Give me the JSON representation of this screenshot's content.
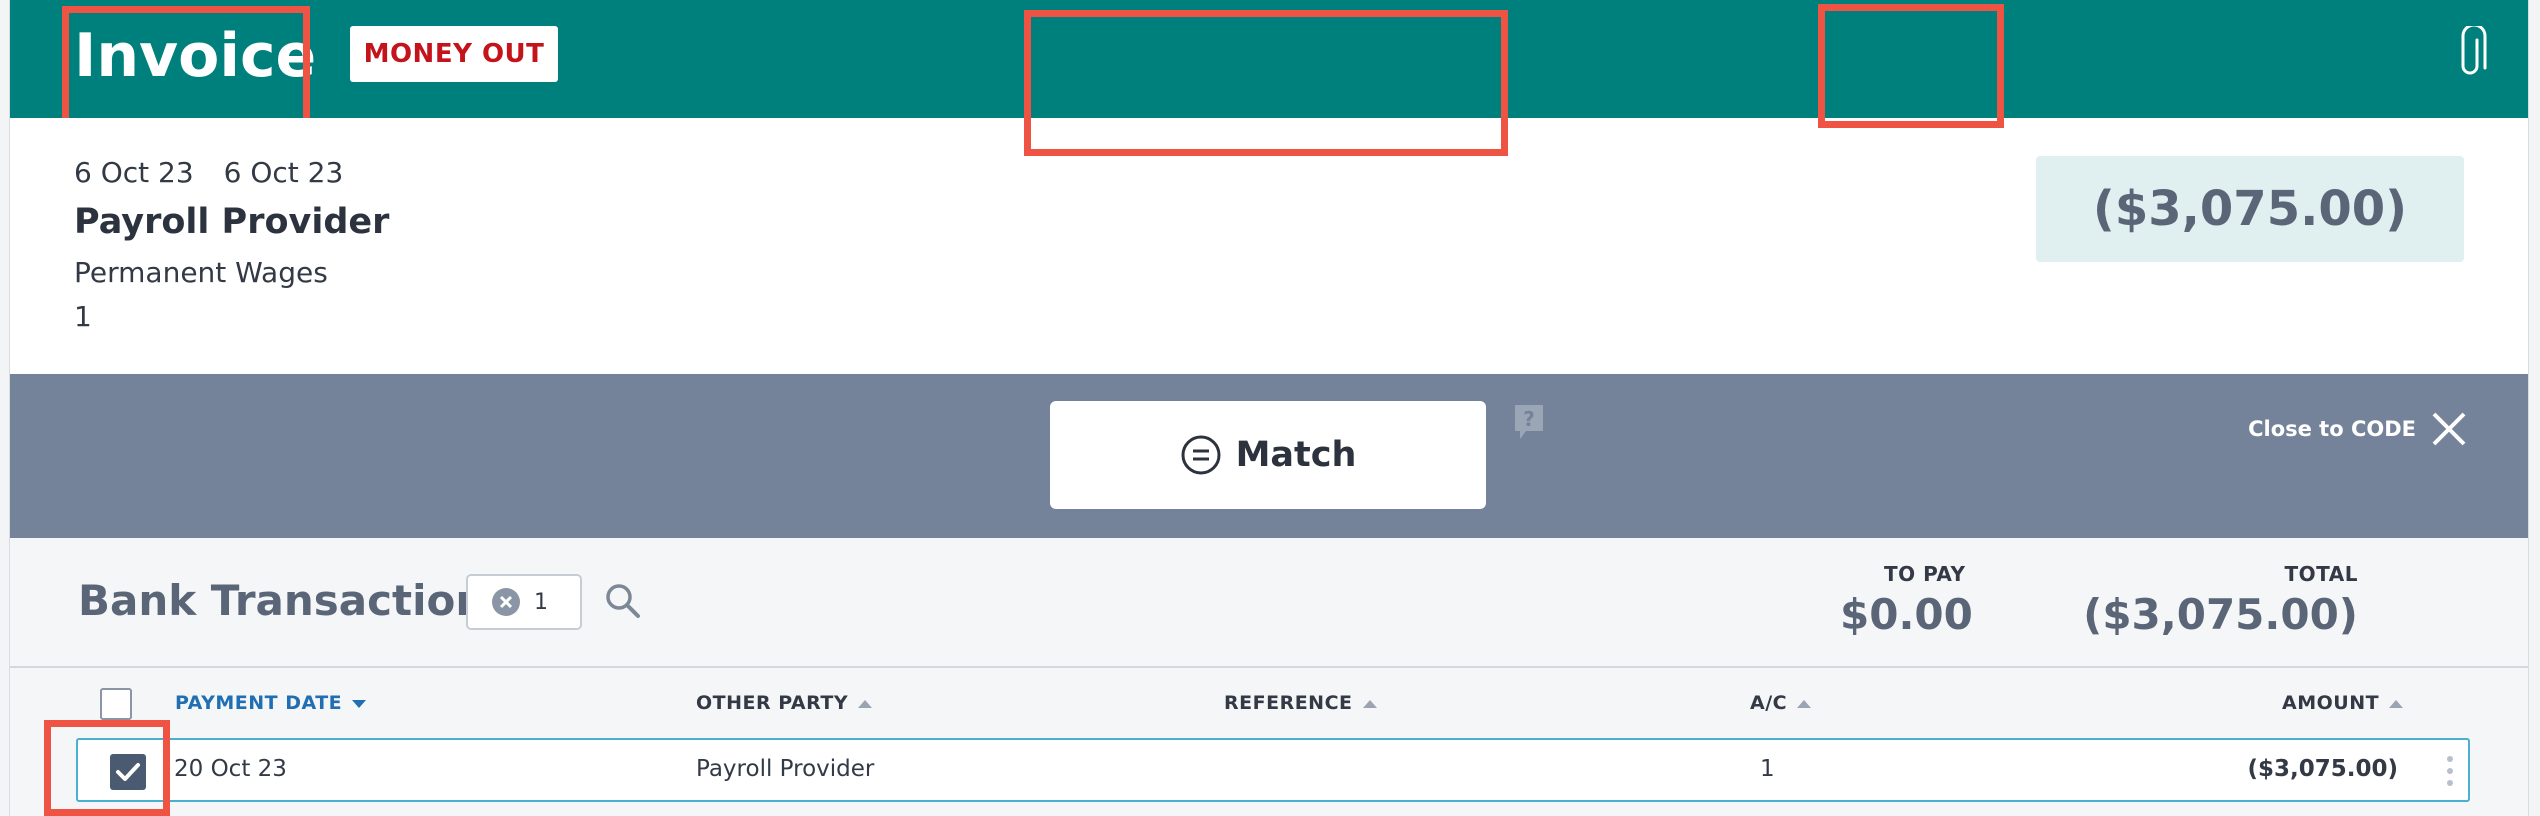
{
  "header": {
    "title": "Invoice",
    "badge": "MONEY OUT",
    "attach_icon": "paperclip-icon"
  },
  "details": {
    "date": "6 Oct 23",
    "due_date": "6 Oct 23",
    "party": "Payroll Provider",
    "account": "Permanent Wages",
    "reference": "1",
    "amount": "($3,075.00)"
  },
  "match_bar": {
    "match_label": "Match",
    "match_icon": "equals-circle-icon",
    "help_icon": "help-bubble-icon",
    "close_label": "Close to CODE",
    "close_icon": "close-icon"
  },
  "bank_transactions": {
    "title": "Bank Transactions",
    "filter_count": "1",
    "filter_icon": "clear-filter-icon",
    "search_icon": "search-icon",
    "to_pay_label": "TO PAY",
    "to_pay_value": "$0.00",
    "total_label": "TOTAL",
    "total_value": "($3,075.00)"
  },
  "table": {
    "columns": {
      "payment_date": "PAYMENT DATE",
      "other_party": "OTHER PARTY",
      "reference": "REFERENCE",
      "ac": "A/C",
      "amount": "AMOUNT"
    },
    "rows": [
      {
        "checked": true,
        "payment_date": "20 Oct 23",
        "other_party": "Payroll Provider",
        "reference": "",
        "ac": "1",
        "amount": "($3,075.00)"
      }
    ]
  },
  "colors": {
    "header_bg": "#00807d",
    "badge_text": "#c4131b",
    "match_bar_bg": "#75839a",
    "amount_box_bg": "#e0efef",
    "highlight": "#ee5344",
    "link_blue": "#1f6fb2",
    "row_border": "#4ab0cf"
  }
}
